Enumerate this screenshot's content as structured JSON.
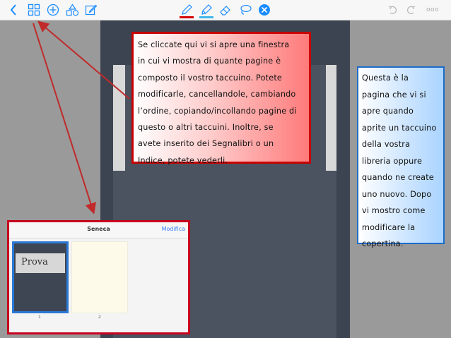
{
  "toolbar": {
    "left_icons": [
      "back-chevron-icon",
      "grid-icon",
      "add-circle-icon",
      "shapes-icon",
      "edit-icon"
    ],
    "center_icons": [
      "pen-icon",
      "highlighter-icon",
      "eraser-icon",
      "lasso-icon",
      "close-icon"
    ],
    "right_icons": [
      "undo-icon",
      "redo-icon",
      "more-icon"
    ],
    "right_more_label": "ooo",
    "accent_color": "#1a8cff"
  },
  "callout_red": {
    "text": "Se cliccate qui vi si apre una finestra\nin cui vi mostra di quante pagine è\ncomposto il vostro taccuino. Potete\nmodificarle, cancellandole, cambiando\nl’ordine, copiando/incollando pagine di\nquesto o altri taccuini. Inoltre, se\navete inserito dei Segnalibri o un\nIndice, potete vederli."
  },
  "callout_blue": {
    "text": "Questa è la\npagina che vi si\napre quando\naprite un taccuino\ndella vostra\nlibreria oppure\nquando ne create\nuno nuovo. Dopo\nvi mostro come\nmodificare la\ncopertina."
  },
  "inset": {
    "title": "Seneca",
    "edit_label": "Modifica",
    "pages": [
      {
        "label": "Prova",
        "number": "1"
      },
      {
        "label": "",
        "number": "2"
      }
    ]
  }
}
